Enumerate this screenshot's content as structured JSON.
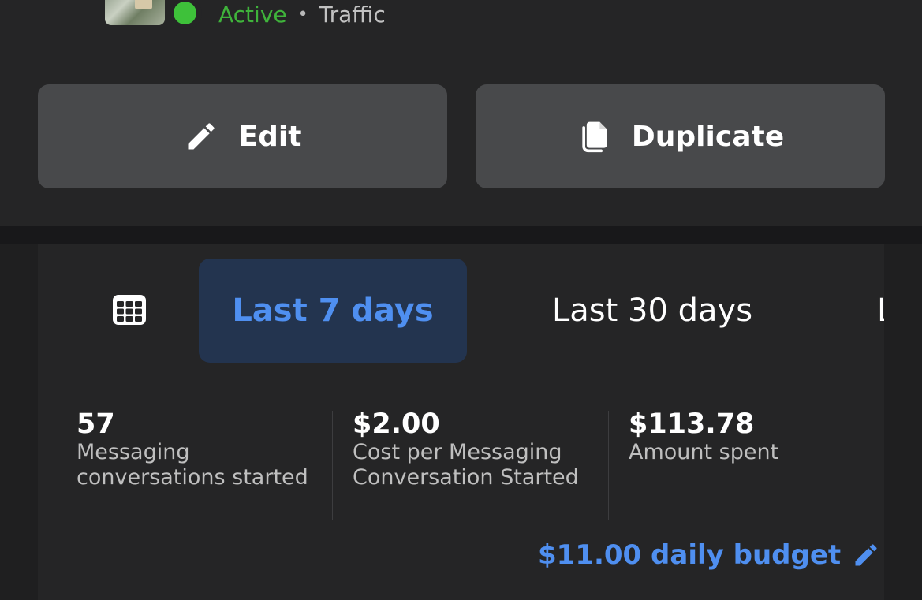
{
  "ad_header": {
    "status": "Active",
    "separator": "•",
    "objective": "Traffic",
    "status_color": "#3fb33b"
  },
  "actions": {
    "edit_label": "Edit",
    "edit_icon": "pencil-icon",
    "duplicate_label": "Duplicate",
    "duplicate_icon": "copy-icon"
  },
  "insights": {
    "date_picker_icon": "calendar-icon",
    "tabs": [
      {
        "label": "Last 7 days",
        "selected": true
      },
      {
        "label": "Last 30 days",
        "selected": false
      },
      {
        "label": "L",
        "selected": false
      }
    ],
    "metrics": [
      {
        "value": "57",
        "label": "Messaging conversations started"
      },
      {
        "value": "$2.00",
        "label": "Cost per Messaging Conversation Started"
      },
      {
        "value": "$113.78",
        "label": "Amount spent"
      }
    ],
    "budget": {
      "label": "$11.00 daily budget",
      "icon": "pencil-icon"
    },
    "accent_color": "#4f8ff0"
  }
}
